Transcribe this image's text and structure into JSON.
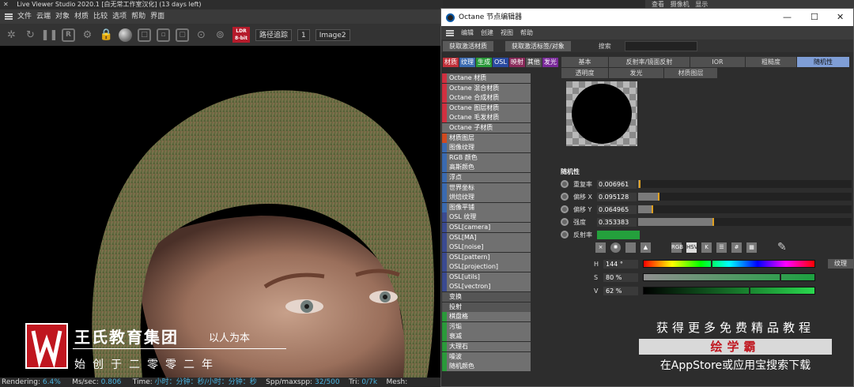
{
  "liveviewer": {
    "title": "Live Viewer Studio 2020.1 [白无常工作室汉化] (13 days left)",
    "menu": [
      "文件",
      "云端",
      "对象",
      "材质",
      "比较",
      "选项",
      "帮助",
      "界面"
    ],
    "ldr_label": "LDR 8-bit",
    "path_select": "路径追踪",
    "num_select": "1",
    "image_select": "Image2",
    "status": {
      "rendering_label": "Rendering:",
      "rendering_value": "6.4%",
      "ms_label": "Ms/sec:",
      "ms_value": "0.806",
      "time_label": "Time:",
      "time_value": "小时：分钟：秒/小时：分钟：秒",
      "spp_label": "Spp/maxspp:",
      "spp_value": "32/500",
      "tri_label": "Tri:",
      "tri_value": "0/7k",
      "mesh_label": "Mesh:"
    }
  },
  "watermark": {
    "name": "王氏教育集团",
    "slogan": "以人为本",
    "since": "始创于二零零二年"
  },
  "c4d_topbar": [
    "查看",
    "摄像机",
    "显示"
  ],
  "octane": {
    "title": "Octane 节点编辑器",
    "menu": [
      "编辑",
      "创建",
      "视图",
      "帮助"
    ],
    "btn_get_material": "获取激活材质",
    "btn_get_tag": "获取激活标签/对象",
    "search_label": "搜索",
    "categories": [
      {
        "label": "材质",
        "color": "#c0303a"
      },
      {
        "label": "纹理",
        "color": "#3a6ab0"
      },
      {
        "label": "生成",
        "color": "#2a9a3a"
      },
      {
        "label": "OSL",
        "color": "#2a4aa0"
      },
      {
        "label": "映射",
        "color": "#8a2a5a"
      },
      {
        "label": "其他",
        "color": "#555555"
      },
      {
        "label": "发光",
        "color": "#7a2a9a"
      }
    ],
    "palette": [
      {
        "label": "Octane 材质",
        "color": "#d03040"
      },
      {
        "label": "Octane 混合材质",
        "color": "#d03040"
      },
      {
        "label": "Octane 合成材质",
        "color": "#d03040"
      },
      {
        "label": "Octane 图层材质",
        "color": "#d03040"
      },
      {
        "label": "Octane 毛发材质",
        "color": "#d03040"
      },
      {
        "label": "Octane 子材质",
        "color": "#707070"
      },
      {
        "label": "材质图层",
        "color": "#d04a20"
      },
      {
        "label": "图像纹理",
        "color": "#3a6ab0"
      },
      {
        "label": "RGB 颜色",
        "color": "#3a6ab0"
      },
      {
        "label": "高斯颜色",
        "color": "#3a6ab0"
      },
      {
        "label": "浮点",
        "color": "#3a6ab0"
      },
      {
        "label": "世界坐标",
        "color": "#3a6ab0"
      },
      {
        "label": "烘焙纹理",
        "color": "#3a6ab0"
      },
      {
        "label": "图像平铺",
        "color": "#3a6ab0"
      },
      {
        "label": "OSL 纹理",
        "color": "#3a4a90"
      },
      {
        "label": "OSL[camera]",
        "color": "#3a4a90"
      },
      {
        "label": "OSL[MA]",
        "color": "#3a4a90"
      },
      {
        "label": "OSL[noise]",
        "color": "#3a4a90"
      },
      {
        "label": "OSL[pattern]",
        "color": "#3a4a90"
      },
      {
        "label": "OSL[projection]",
        "color": "#3a4a90"
      },
      {
        "label": "OSL[utils]",
        "color": "#3a4a90"
      },
      {
        "label": "OSL[vectron]",
        "color": "#3a4a90"
      },
      {
        "label": "变换",
        "color": "#555555"
      },
      {
        "label": "投射",
        "color": "#555555"
      },
      {
        "label": "棋盘格",
        "color": "#2a9a3a"
      },
      {
        "label": "污垢",
        "color": "#2a9a3a"
      },
      {
        "label": "衰减",
        "color": "#2a9a3a"
      },
      {
        "label": "大理石",
        "color": "#2a9a3a"
      },
      {
        "label": "噪波",
        "color": "#2a9a3a"
      },
      {
        "label": "随机颜色",
        "color": "#2a9a3a"
      }
    ],
    "prop_tabs": [
      "基本",
      "反射率/镜面反射",
      "IOR",
      "粗糙度",
      "随机性",
      "透明度",
      "发光",
      "材质图层"
    ],
    "section_title": "随机性",
    "params": [
      {
        "label": "重复率",
        "value": "0.006961",
        "fraction": 0.006961
      },
      {
        "label": "偏移 X",
        "value": "0.095128",
        "fraction": 0.095128
      },
      {
        "label": "偏移 Y",
        "value": "0.064965",
        "fraction": 0.064965
      },
      {
        "label": "强度",
        "value": "0.353383",
        "fraction": 0.353383
      }
    ],
    "reflect_label": "反射率",
    "reflect_color": "#24a03c",
    "color_tools": [
      "RGB",
      "HSV",
      "K"
    ],
    "hsv": [
      {
        "label": "H",
        "value": "144 °",
        "fraction": 0.4
      },
      {
        "label": "S",
        "value": "80 %",
        "fraction": 0.8
      },
      {
        "label": "V",
        "value": "62 %",
        "fraction": 0.62
      }
    ],
    "texture_btn": "纹理"
  },
  "promo": {
    "line1": "获得更多免费精品教程",
    "line2": "绘学霸",
    "line3": "在AppStore或应用宝搜索下载"
  }
}
